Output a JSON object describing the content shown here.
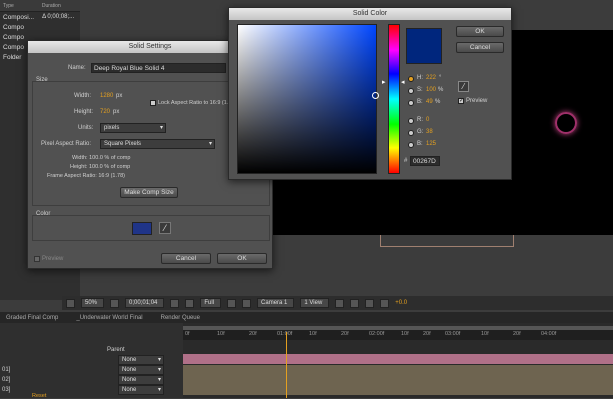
{
  "project": {
    "header_type": "Type",
    "header_duration": "Duration",
    "rows": [
      {
        "name": "Composi...",
        "duration": "Δ 0;00;08;..."
      },
      {
        "name": "Compo",
        "duration": ""
      },
      {
        "name": "Compo",
        "duration": ""
      },
      {
        "name": "Compo",
        "duration": ""
      },
      {
        "name": "Folder",
        "duration": ""
      }
    ]
  },
  "solid_settings": {
    "title": "Solid Settings",
    "name_label": "Name:",
    "name_value": "Deep Royal Blue Solid 4",
    "size_label": "Size",
    "width_label": "Width:",
    "width_value": "1280",
    "width_unit": "px",
    "height_label": "Height:",
    "height_value": "720",
    "height_unit": "px",
    "lock_label": "Lock Aspect Ratio to 16:9 (1.78)",
    "units_label": "Units:",
    "units_value": "pixels",
    "par_label": "Pixel Aspect Ratio:",
    "par_value": "Square Pixels",
    "info_width": "Width: 100.0 % of comp",
    "info_height": "Height: 100.0 % of comp",
    "info_frame": "Frame Aspect Ratio: 16:9 (1.78)",
    "make_comp_size": "Make Comp Size",
    "color_label": "Color",
    "color_swatch": "#1f3488",
    "preview_label": "Preview",
    "cancel": "Cancel",
    "ok": "OK"
  },
  "solid_color": {
    "title": "Solid Color",
    "ok": "OK",
    "cancel": "Cancel",
    "preview_label": "Preview",
    "h_label": "H:",
    "h_value": "222",
    "h_unit": "°",
    "s_label": "S:",
    "s_value": "100",
    "s_unit": "%",
    "b_label": "B:",
    "b_value": "49",
    "b_unit": "%",
    "r_label": "R:",
    "r_value": "0",
    "g_label": "G:",
    "g_value": "38",
    "bl_label": "B:",
    "bl_value": "125",
    "hex_label": "#",
    "hex_value": "00267D",
    "color": "#00267d"
  },
  "viewer_toolbar": {
    "zoom": "50%",
    "timecode": "0;00;01;04",
    "resolution": "Full",
    "camera": "Camera 1",
    "views": "1 View",
    "exposure": "+0.0"
  },
  "timeline": {
    "tabs": [
      "Graded Final Comp",
      "_Underwater World Final",
      "Render Queue"
    ],
    "parent_header": "Parent",
    "ticks": [
      "0f",
      "10f",
      "20f",
      "01:00f",
      "10f",
      "20f",
      "02:00f",
      "10f",
      "20f",
      "03:00f",
      "10f",
      "20f",
      "04:00f"
    ],
    "parent_values": [
      "None",
      "None",
      "None",
      "None"
    ],
    "layer_ids": [
      "01]",
      "02]",
      "03]"
    ],
    "reset_label": "Reset"
  }
}
